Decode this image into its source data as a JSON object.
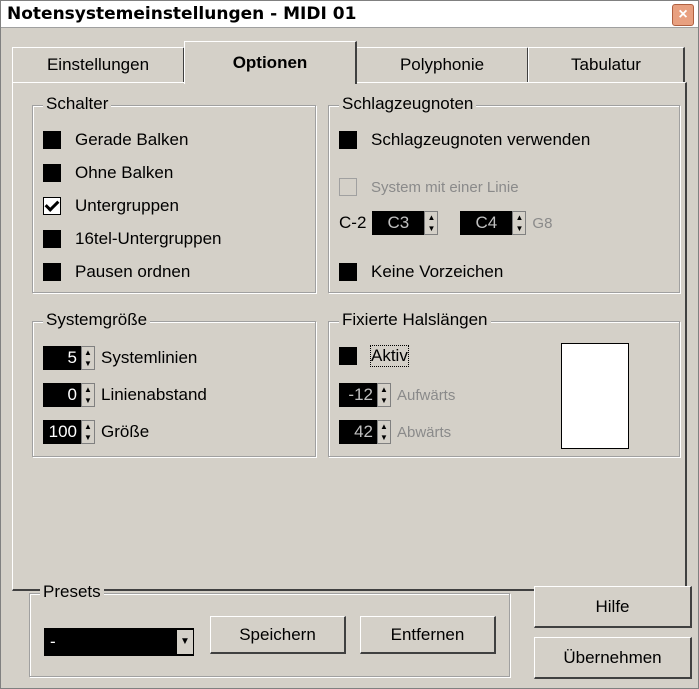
{
  "window": {
    "title": "Notensystemeinstellungen - MIDI 01",
    "close": "×"
  },
  "tabs": [
    {
      "label": "Einstellungen"
    },
    {
      "label": "Optionen"
    },
    {
      "label": "Polyphonie"
    },
    {
      "label": "Tabulatur"
    }
  ],
  "schalter": {
    "title": "Schalter",
    "items": [
      {
        "label": "Gerade Balken",
        "checked": false
      },
      {
        "label": "Ohne Balken",
        "checked": false
      },
      {
        "label": "Untergruppen",
        "checked": true
      },
      {
        "label": "16tel-Untergruppen",
        "checked": false
      },
      {
        "label": "Pausen ordnen",
        "checked": false
      }
    ]
  },
  "schlagzeug": {
    "title": "Schlagzeugnoten",
    "use_label": "Schlagzeugnoten verwenden",
    "single_line_label": "System mit einer Linie",
    "range_low_label": "C-2",
    "range_from": "C3",
    "range_to": "C4",
    "range_high_label": "G8",
    "no_accidentals_label": "Keine Vorzeichen"
  },
  "systemgroesse": {
    "title": "Systemgröße",
    "items": [
      {
        "value": "5",
        "label": "Systemlinien"
      },
      {
        "value": "0",
        "label": "Linienabstand"
      },
      {
        "value": "100",
        "label": "Größe"
      }
    ]
  },
  "hals": {
    "title": "Fixierte Halslängen",
    "active_label": "Aktiv",
    "up_value": "-12",
    "up_label": "Aufwärts",
    "down_value": "42",
    "down_label": "Abwärts"
  },
  "presets": {
    "title": "Presets",
    "selected": "-",
    "save_label": "Speichern",
    "remove_label": "Entfernen"
  },
  "buttons": {
    "help": "Hilfe",
    "apply": "Übernehmen"
  },
  "icons": {
    "spin_up": "▲",
    "spin_down": "▼",
    "dropdown": "▼"
  }
}
